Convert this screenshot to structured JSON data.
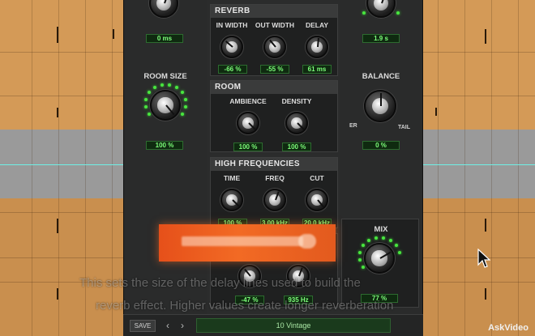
{
  "left_column": {
    "top_value": "0 ms",
    "room_size_label": "ROOM SIZE",
    "room_size_value": "100 %"
  },
  "reverb": {
    "title": "REVERB",
    "knobs": [
      {
        "label": "IN WIDTH",
        "value": "-66 %"
      },
      {
        "label": "OUT WIDTH",
        "value": "-55 %"
      },
      {
        "label": "DELAY",
        "value": "61 ms"
      }
    ]
  },
  "room": {
    "title": "ROOM",
    "knobs": [
      {
        "label": "AMBIENCE",
        "value": "100 %"
      },
      {
        "label": "DENSITY",
        "value": "100 %"
      }
    ]
  },
  "high_frequencies": {
    "title": "HIGH FREQUENCIES",
    "knobs": [
      {
        "label": "TIME",
        "value": "100 %"
      },
      {
        "label": "FREQ",
        "value": "3.00 kHz"
      },
      {
        "label": "CUT",
        "value": "20.0 kHz"
      }
    ]
  },
  "lower_knobs": [
    {
      "value": "-47 %"
    },
    {
      "value": "935 Hz"
    }
  ],
  "right_column": {
    "top_value": "1.9 s",
    "balance_label": "BALANCE",
    "balance_left": "ER",
    "balance_right": "TAIL",
    "balance_value": "0 %",
    "mix_label": "MIX",
    "mix_value": "77 %"
  },
  "bottom_bar": {
    "save_label": "SAVE",
    "prev_icon": "‹",
    "next_icon": "›",
    "preset_name": "10 Vintage"
  },
  "subtitles": [
    "This sets the size of the delay lines used to build the",
    "reverb effect. Higher values create longer reverberation"
  ],
  "logo": "AskVideo",
  "colors": {
    "accent_green": "#7dff7a",
    "banner_orange": "#f26a24",
    "track_orange": "#d49a57"
  }
}
